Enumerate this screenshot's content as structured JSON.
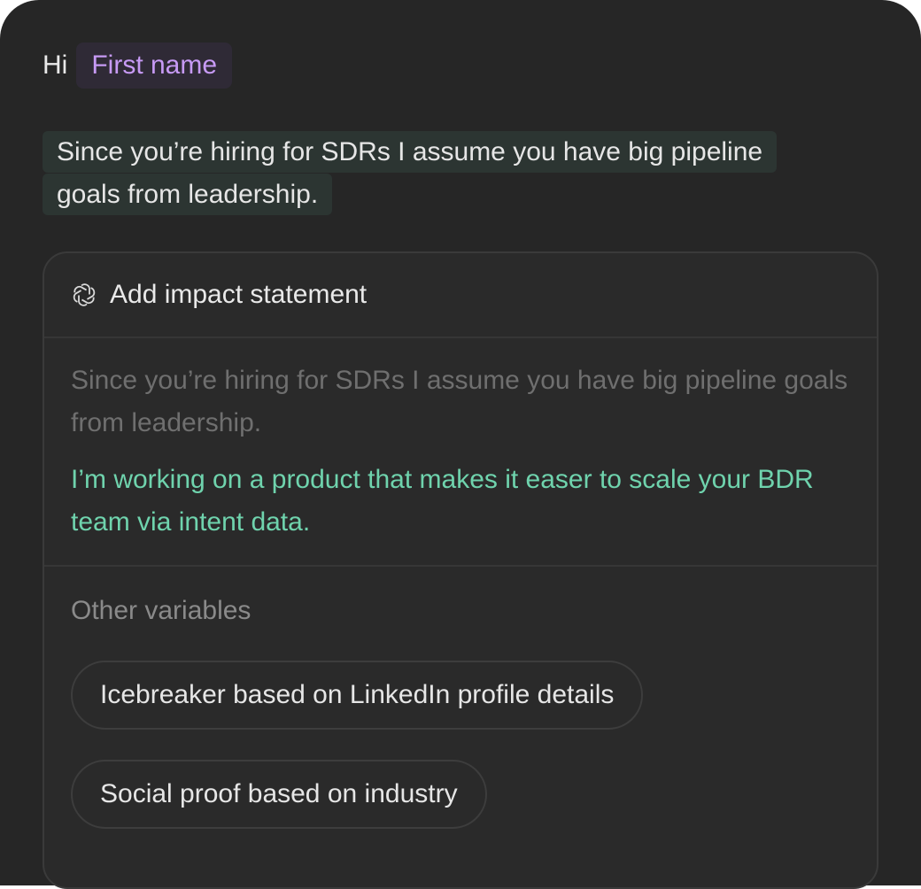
{
  "greeting": {
    "prefix": "Hi",
    "variable": "First name"
  },
  "intro_text": "Since you’re hiring for SDRs I assume you have big pipeline goals from leadership.",
  "card": {
    "icon": "openai-logo-icon",
    "title": "Add impact statement",
    "preview_existing": "Since you’re hiring for SDRs I assume you have big pipeline goals from leadership.",
    "preview_added": "I’m working on a product that makes it easer to scale your BDR team via intent data."
  },
  "other_variables": {
    "label": "Other variables",
    "items": [
      "Icebreaker based on LinkedIn profile details",
      "Social proof based on industry"
    ]
  },
  "colors": {
    "background": "#262626",
    "variable_text": "#c79af5",
    "accent_text": "#6fd3ad",
    "muted_text": "#6f6f6f"
  }
}
